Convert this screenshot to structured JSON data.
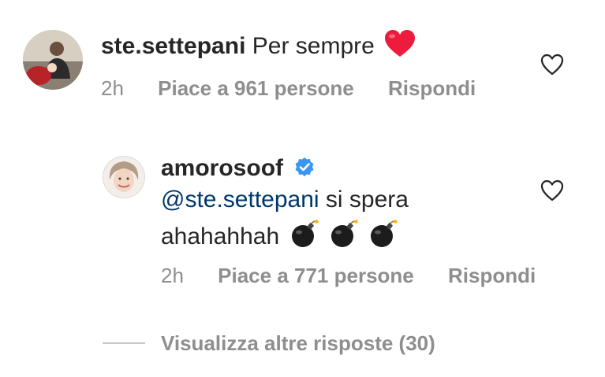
{
  "comments": [
    {
      "username": "ste.settepani",
      "text": "Per sempre",
      "emoji": "red-heart-emoji",
      "time": "2h",
      "likes": "Piace a 961 persone",
      "reply": "Rispondi",
      "avatar": "profile-photo"
    }
  ],
  "reply": {
    "username": "amorosoof",
    "verified": true,
    "mention": "@ste.settepani",
    "text_line1": "si spera",
    "text_line2": "ahahahhah",
    "emoji": "bomb-emoji",
    "emoji_count": 3,
    "time": "2h",
    "likes": "Piace a 771 persone",
    "reply": "Rispondi",
    "avatar": "profile-photo"
  },
  "view_more": "Visualizza altre risposte (30)",
  "colors": {
    "text": "#262626",
    "secondary": "#8e8e8e",
    "mention": "#00376b",
    "verified": "#3897f0",
    "heart_emoji": "#ed1c3c"
  }
}
